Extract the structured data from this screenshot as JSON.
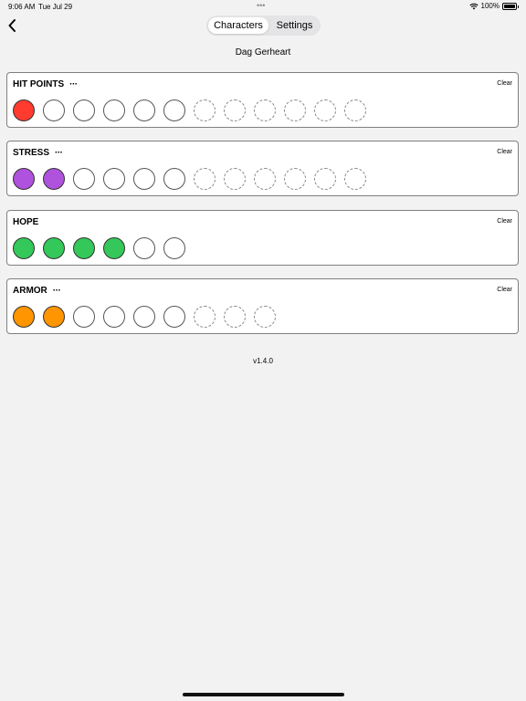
{
  "status": {
    "time": "9:06 AM",
    "date": "Tue Jul 29",
    "battery": "100%"
  },
  "nav": {
    "tabs": [
      {
        "label": "Characters",
        "active": true
      },
      {
        "label": "Settings",
        "active": false
      }
    ]
  },
  "character": {
    "name": "Dag Gerheart"
  },
  "clear_label": "Clear",
  "more_label": "···",
  "trackers": [
    {
      "title": "HIT POINTS",
      "has_more": true,
      "filled": 1,
      "available": 6,
      "max": 12,
      "color": "#ff3b30"
    },
    {
      "title": "STRESS",
      "has_more": true,
      "filled": 2,
      "available": 6,
      "max": 12,
      "color": "#af52de"
    },
    {
      "title": "HOPE",
      "has_more": false,
      "filled": 4,
      "available": 6,
      "max": 6,
      "color": "#34c759"
    },
    {
      "title": "ARMOR",
      "has_more": true,
      "filled": 2,
      "available": 6,
      "max": 9,
      "color": "#ff9500"
    }
  ],
  "footer": {
    "version": "v1.4.0"
  }
}
